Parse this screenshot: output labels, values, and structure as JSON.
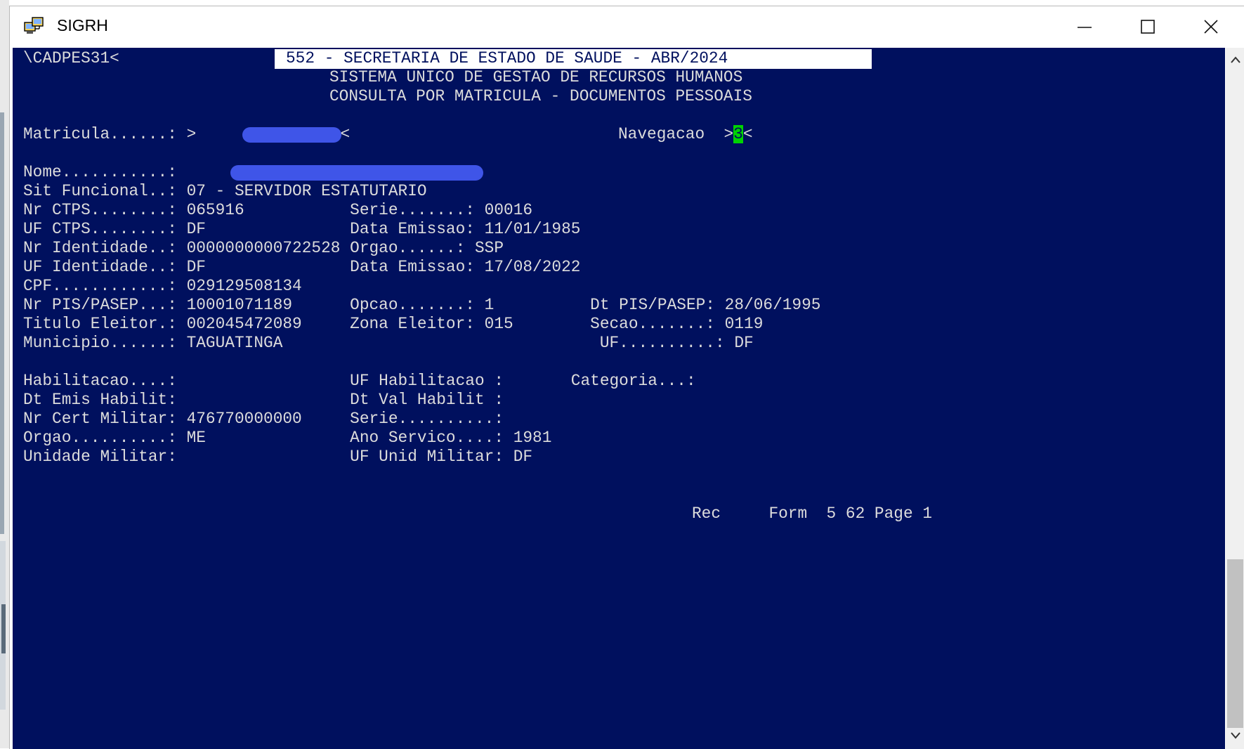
{
  "window": {
    "title": "SIGRH",
    "minimize": "—",
    "maximize": "☐",
    "close": "✕",
    "icon": "sigrh-app-icon"
  },
  "terminal": {
    "program": "\\CADPES31<",
    "header_line1": "552 - SECRETARIA DE ESTADO DE SAUDE - ABR/2024",
    "header_line2": "SISTEMA UNICO DE GESTAO DE RECURSOS HUMANOS",
    "header_line3": "CONSULTA POR MATRICULA - DOCUMENTOS PESSOAIS",
    "matricula": {
      "label": "Matricula......: >",
      "end": "<"
    },
    "navegacao": {
      "label": "Navegacao  >",
      "value": "3",
      "end": "<"
    },
    "nome_label": "Nome...........:",
    "lines": {
      "sit_funcional": "Sit Funcional..: 07 - SERVIDOR ESTATUTARIO",
      "ctps": "Nr CTPS........: 065916           Serie.......: 00016",
      "uf_ctps": "UF CTPS........: DF               Data Emissao: 11/01/1985",
      "identidade": "Nr Identidade..: 0000000000722528 Orgao......: SSP",
      "uf_identidade": "UF Identidade..: DF               Data Emissao: 17/08/2022",
      "cpf": "CPF............: 029129508134",
      "pis": "Nr PIS/PASEP...: 10001071189      Opcao.......: 1          Dt PIS/PASEP: 28/06/1995",
      "titulo": "Titulo Eleitor.: 002045472089     Zona Eleitor: 015        Secao.......: 0119",
      "municipio": "Municipio......: TAGUATINGA                                 UF..........: DF",
      "habilitacao": "Habilitacao....:                  UF Habilitacao :       Categoria...:",
      "dt_emis_hab": "Dt Emis Habilit:                  Dt Val Habilit :",
      "cert_militar": "Nr Cert Militar: 476770000000     Serie..........:",
      "orgao": "Orgao..........: ME               Ano Servico....: 1981",
      "unidade_militar": "Unidade Militar:                  UF Unid Militar: DF"
    },
    "status_line": "Rec     Form  5 62 Page 1"
  },
  "colors": {
    "terminal_bg": "#00105e",
    "terminal_text": "#dcdcdc",
    "cursor": "#00d400",
    "redaction": "#3f55e8"
  }
}
